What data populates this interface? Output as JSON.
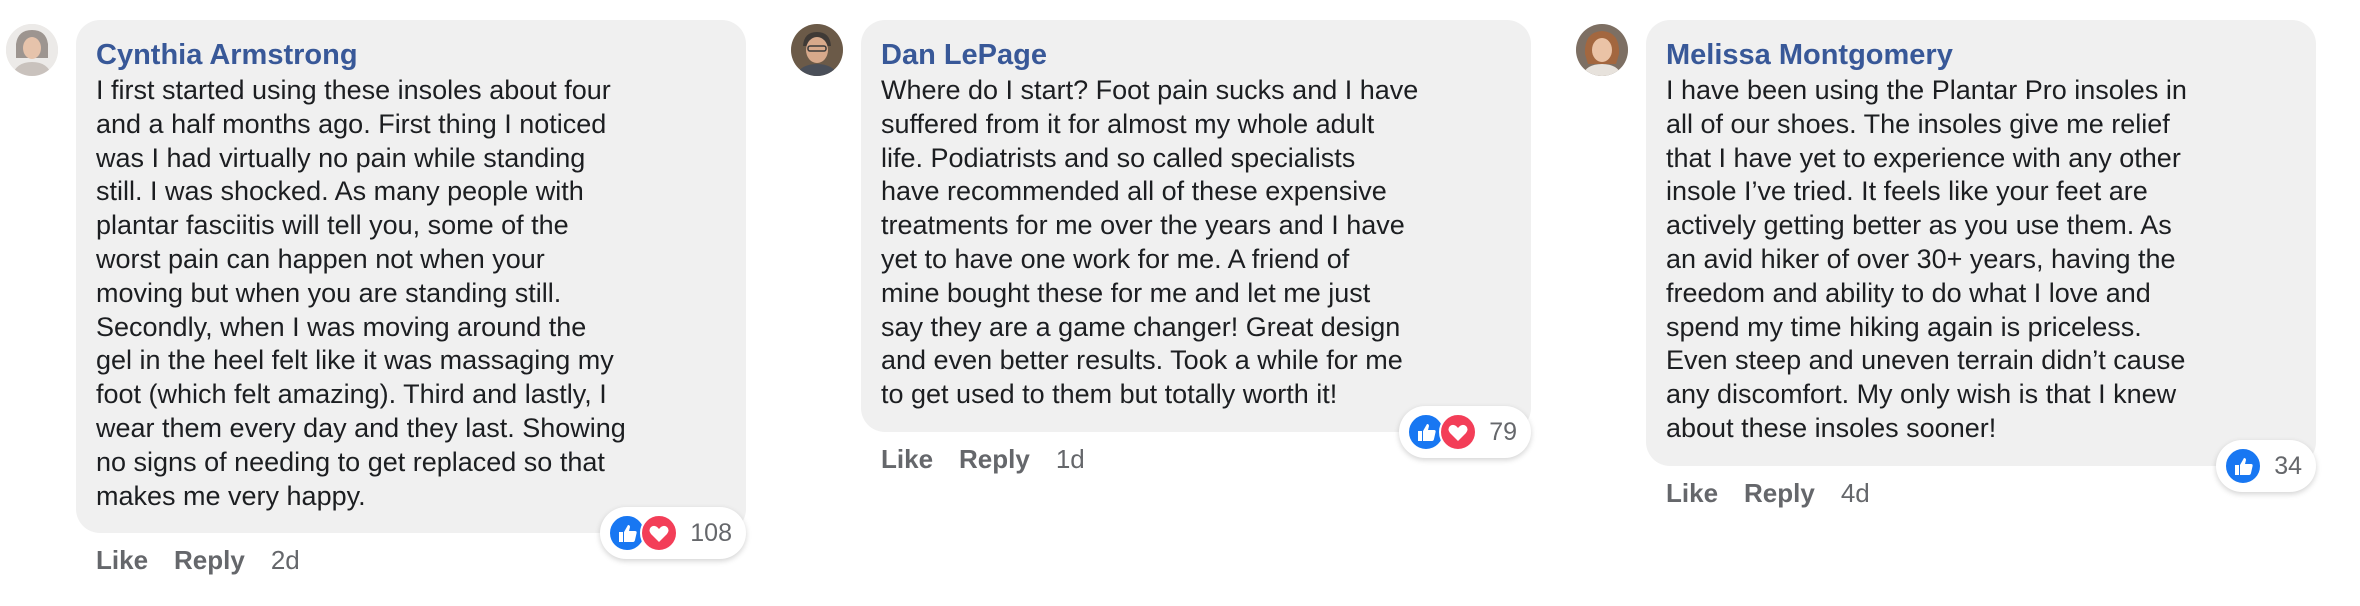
{
  "comments": [
    {
      "author": "Cynthia Armstrong",
      "text": "I first started using these insoles about four\nand a half months ago. First thing I noticed\nwas I had virtually no pain while standing\nstill. I was shocked. As many people with\nplantar fasciitis will tell you, some of the\nworst pain can happen not when your\nmoving but when you are standing still.\nSecondly, when I was moving around the\ngel in the heel felt like it was massaging my\nfoot (which felt amazing). Third and lastly, I\nwear them every day and they last. Showing\nno signs of needing to get replaced so that\nmakes me very happy.",
      "reactions": [
        "like",
        "love"
      ],
      "reaction_count": "108",
      "like_label": "Like",
      "reply_label": "Reply",
      "time": "2d"
    },
    {
      "author": "Dan LePage",
      "text": "Where do I start? Foot pain sucks and I have\nsuffered from it for almost my whole adult\nlife. Podiatrists and so called specialists\nhave recommended all of these expensive\ntreatments for me over the years and I have\nyet to have one work for me. A friend of\nmine bought these for me and let me just\nsay they are a game changer! Great design\nand even better results. Took a while for me\nto get used to them but totally worth it!",
      "reactions": [
        "like",
        "love"
      ],
      "reaction_count": "79",
      "like_label": "Like",
      "reply_label": "Reply",
      "time": "1d"
    },
    {
      "author": "Melissa Montgomery",
      "text": "I have been using the Plantar Pro insoles in\nall of our shoes. The insoles give me relief\nthat I have yet to experience with any other\ninsole I’ve tried. It feels like your feet are\nactively getting better as you use them. As\nan avid hiker of over 30+ years, having the\nfreedom and ability to do what I love and\nspend my time hiking again is priceless.\nEven steep and uneven terrain didn’t cause\nany discomfort. My only wish is that I knew\nabout these insoles sooner!",
      "reactions": [
        "like"
      ],
      "reaction_count": "34",
      "like_label": "Like",
      "reply_label": "Reply",
      "time": "4d"
    }
  ],
  "colors": {
    "author": "#385898",
    "bubble": "#f0f0f0",
    "meta": "#65676b",
    "like": "#1877f2",
    "love": "#f33e58"
  }
}
